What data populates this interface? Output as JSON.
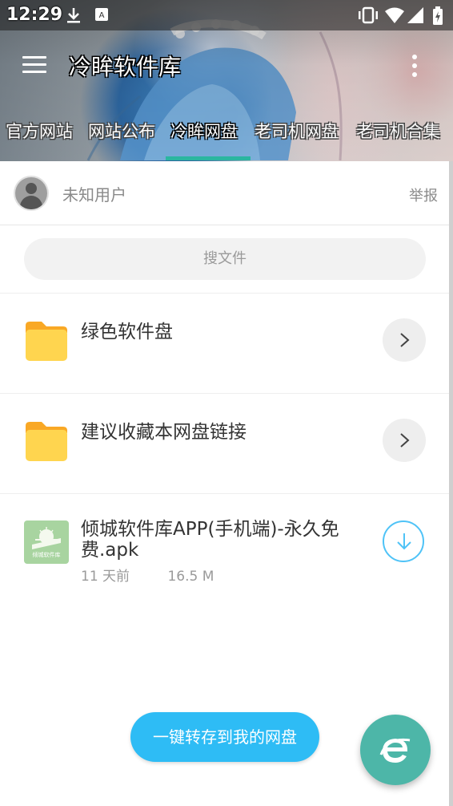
{
  "status_bar": {
    "time": "12:29",
    "icons": [
      "download-icon",
      "keyboard-icon",
      "vibrate-icon",
      "wifi-icon",
      "signal-icon",
      "battery-charging-icon"
    ]
  },
  "toolbar": {
    "title": "冷眸软件库",
    "menu_icon": "menu-icon",
    "more_icon": "more-vert-icon"
  },
  "tabs": [
    {
      "label": "官方网站",
      "active": false
    },
    {
      "label": "网站公布",
      "active": false
    },
    {
      "label": "冷眸网盘",
      "active": true
    },
    {
      "label": "老司机网盘",
      "active": false
    },
    {
      "label": "老司机合集",
      "active": false
    }
  ],
  "user": {
    "name": "未知用户",
    "report_label": "举报"
  },
  "search": {
    "placeholder": "搜文件"
  },
  "items": [
    {
      "type": "folder",
      "title": "绿色软件盘",
      "icon": "folder-icon"
    },
    {
      "type": "folder",
      "title": "建议收藏本网盘链接",
      "icon": "folder-icon"
    }
  ],
  "file": {
    "title": "倾城软件库APP(手机端)-永久免费.apk",
    "age": "11 天前",
    "size": "16.5 M",
    "icon_label": "倾城软件库"
  },
  "actions": {
    "save_label": "一键转存到我的网盘",
    "fab_icon": "browser-e-icon"
  },
  "colors": {
    "accent": "#2bb6a0",
    "save_button": "#2ebcf5",
    "fab": "#4db6a8",
    "folder": "#ffd54f"
  }
}
